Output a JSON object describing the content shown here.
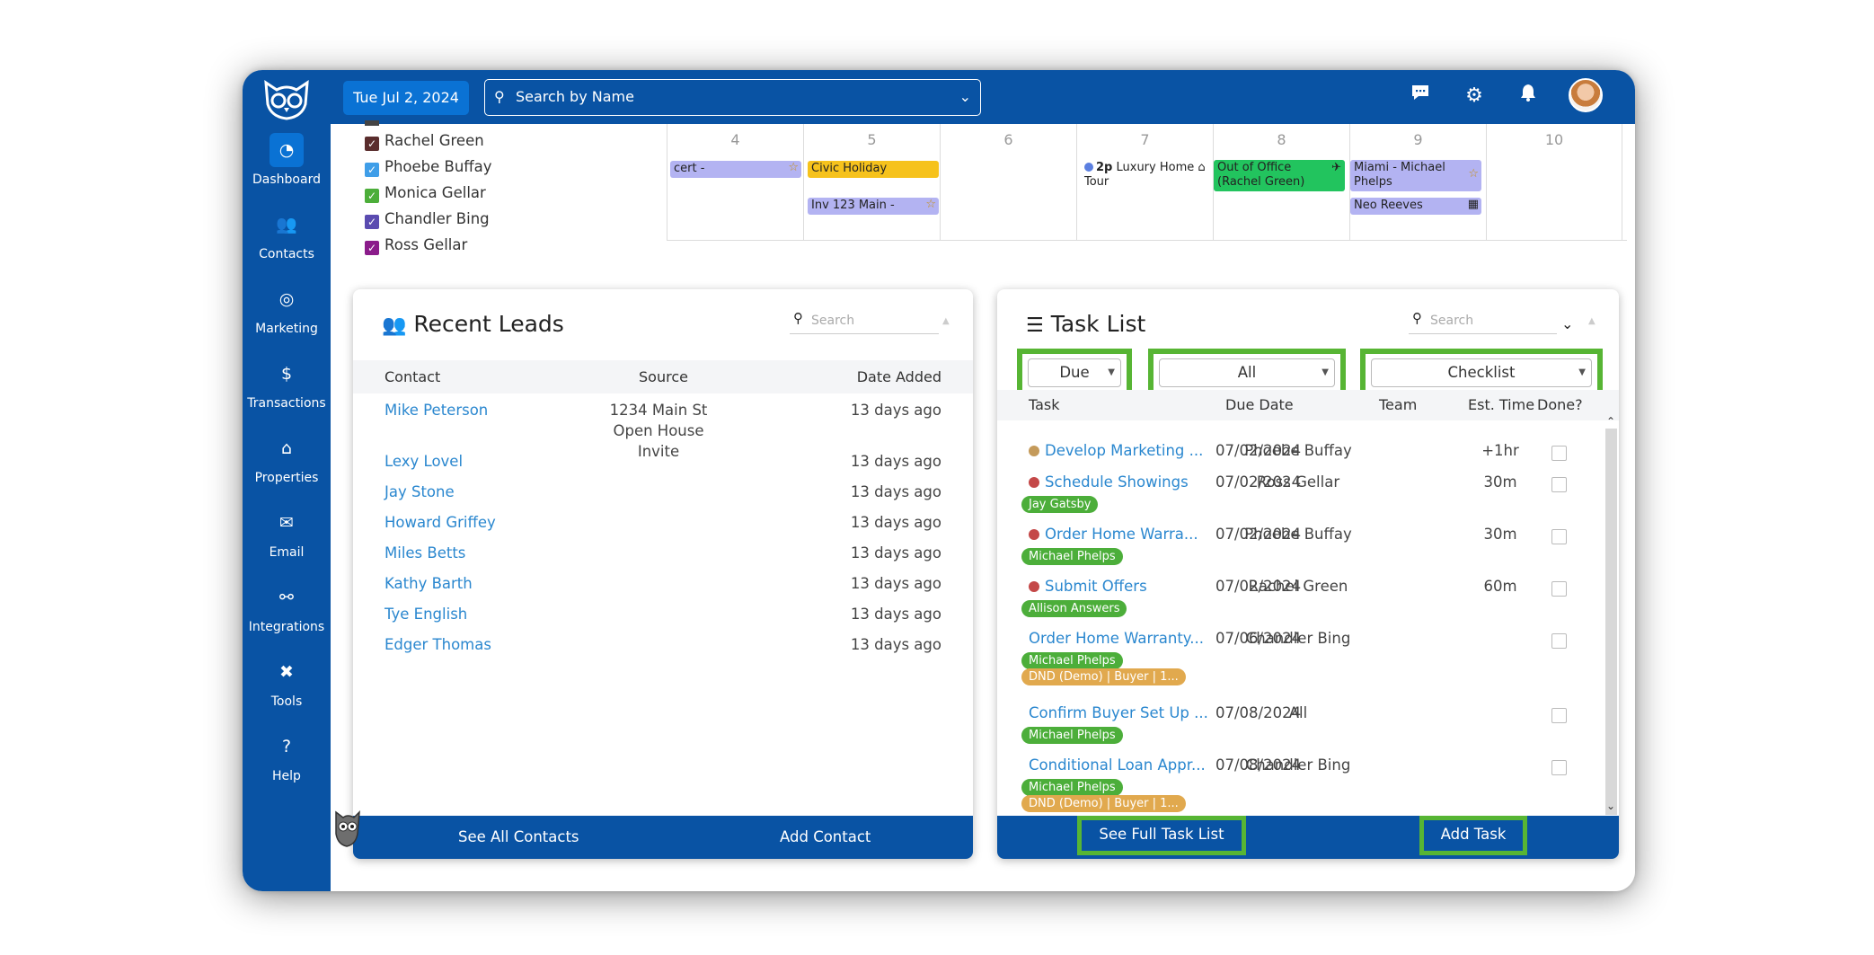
{
  "topbar": {
    "date": "Tue Jul 2, 2024",
    "search_placeholder": "Search by Name"
  },
  "sidebar": {
    "items": [
      {
        "label": "Dashboard",
        "icon": "dashboard-icon",
        "glyph": "◔"
      },
      {
        "label": "Contacts",
        "icon": "contacts-icon",
        "glyph": "👥"
      },
      {
        "label": "Marketing",
        "icon": "marketing-icon",
        "glyph": "◎"
      },
      {
        "label": "Transactions",
        "icon": "dollar-icon",
        "glyph": "$"
      },
      {
        "label": "Properties",
        "icon": "home-icon",
        "glyph": "⌂"
      },
      {
        "label": "Email",
        "icon": "envelope-icon",
        "glyph": "✉"
      },
      {
        "label": "Integrations",
        "icon": "link-icon",
        "glyph": "⚯"
      },
      {
        "label": "Tools",
        "icon": "tools-icon",
        "glyph": "✖"
      },
      {
        "label": "Help",
        "icon": "help-icon",
        "glyph": "?"
      }
    ]
  },
  "agents": [
    {
      "name": "Rachel Green",
      "color": "#5a2d2d"
    },
    {
      "name": "Phoebe Buffay",
      "color": "#3f9ee8"
    },
    {
      "name": "Monica Gellar",
      "color": "#4cae3a"
    },
    {
      "name": "Chandler Bing",
      "color": "#5a4bb0"
    },
    {
      "name": "Ross Gellar",
      "color": "#8b1c8b"
    }
  ],
  "calendar": {
    "days": [
      "4",
      "5",
      "6",
      "7",
      "8",
      "9",
      "10"
    ],
    "events": {
      "e1": "cert -",
      "e2": "Civic Holiday",
      "e3": "Inv 123 Main -",
      "e4_time": "2p",
      "e4_title": "Luxury Home",
      "e4_title2": "Tour",
      "e5": "Out of Office (Rachel Green)",
      "e6": "Miami - Michael Phelps",
      "e7": "Neo Reeves"
    }
  },
  "leads": {
    "title": "Recent Leads",
    "search_placeholder": "Search",
    "columns": [
      "Contact",
      "Source",
      "Date Added"
    ],
    "rows": [
      {
        "contact": "Mike Peterson",
        "source": "1234 Main St Open House Invite",
        "date": "13 days ago"
      },
      {
        "contact": "Lexy Lovel",
        "source": "",
        "date": "13 days ago"
      },
      {
        "contact": "Jay Stone",
        "source": "",
        "date": "13 days ago"
      },
      {
        "contact": "Howard Griffey",
        "source": "",
        "date": "13 days ago"
      },
      {
        "contact": "Miles Betts",
        "source": "",
        "date": "13 days ago"
      },
      {
        "contact": "Kathy Barth",
        "source": "",
        "date": "13 days ago"
      },
      {
        "contact": "Tye English",
        "source": "",
        "date": "13 days ago"
      },
      {
        "contact": "Edger Thomas",
        "source": "",
        "date": "13 days ago"
      }
    ],
    "footer": {
      "see_all": "See All Contacts",
      "add": "Add Contact"
    }
  },
  "tasks": {
    "title": "Task List",
    "search_placeholder": "Search",
    "filters": {
      "due": "Due",
      "all": "All",
      "checklist": "Checklist"
    },
    "columns": [
      "Task",
      "Due Date",
      "Team",
      "Est. Time",
      "Done?"
    ],
    "rows": [
      {
        "title": "Develop Marketing ...",
        "due": "07/02/2024",
        "team": "Phoebe Buffay",
        "est": "+1hr",
        "dot": "#c49a5a",
        "tags": []
      },
      {
        "title": "Schedule Showings",
        "due": "07/02/2024",
        "team": "Ross Gellar",
        "est": "30m",
        "dot": "#c44848",
        "tags": [
          "Jay Gatsby"
        ]
      },
      {
        "title": "Order Home Warra...",
        "due": "07/02/2024",
        "team": "Phoebe Buffay",
        "est": "30m",
        "dot": "#c44848",
        "tags": [
          "Michael Phelps"
        ]
      },
      {
        "title": "Submit Offers",
        "due": "07/02/2024",
        "team": "Rachel Green",
        "est": "60m",
        "dot": "#c44848",
        "tags": [
          "Allison Answers"
        ]
      },
      {
        "title": "Order Home Warranty...",
        "due": "07/06/2024",
        "team": "Chandler Bing",
        "est": "",
        "dot": "",
        "tags": [
          "Michael Phelps",
          "DND (Demo) | Buyer | 1..."
        ]
      },
      {
        "title": "Confirm Buyer Set Up ...",
        "due": "07/08/2024",
        "team": "All",
        "est": "",
        "dot": "",
        "tags": [
          "Michael Phelps"
        ]
      },
      {
        "title": "Conditional Loan Appr...",
        "due": "07/08/2024",
        "team": "Chandler Bing",
        "est": "",
        "dot": "",
        "tags": [
          "Michael Phelps",
          "DND (Demo) | Buyer | 1..."
        ]
      }
    ],
    "footer": {
      "see_full": "See Full Task List",
      "add": "Add Task"
    }
  },
  "colors": {
    "brand": "#0953a4",
    "accent": "#0a72d4",
    "highlight": "#57b534",
    "link": "#2a87cf"
  }
}
